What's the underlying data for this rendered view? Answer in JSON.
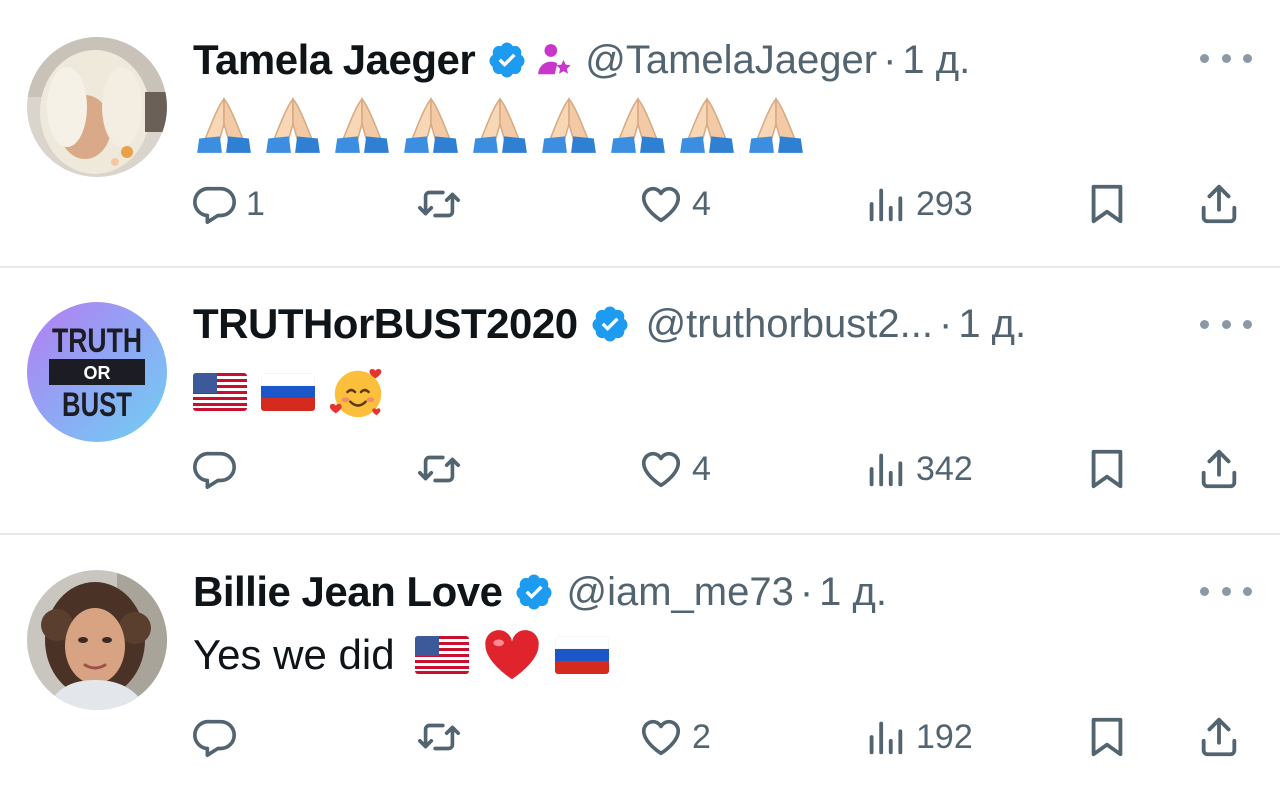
{
  "tweets": [
    {
      "name": "Tamela Jaeger",
      "verified": true,
      "affiliate_badge": "person-star-icon",
      "handle": "@TamelaJaeger",
      "dot": "·",
      "time": "1 д.",
      "text": "",
      "emojis": [
        "🙏🏻",
        "🙏🏻",
        "🙏🏻",
        "🙏🏻",
        "🙏🏻",
        "🙏🏻",
        "🙏🏻",
        "🙏🏻",
        "🙏🏻"
      ],
      "replies": "1",
      "reposts": "",
      "likes": "4",
      "views": "293"
    },
    {
      "name": "TRUTHorBUST2020",
      "verified": true,
      "handle": "@truthorbust2...",
      "dot": "·",
      "time": "1 д.",
      "text": "",
      "emojis": [
        "🇺🇸",
        "🇷🇺",
        "🥰"
      ],
      "avatar_text": [
        "TRUTH",
        "OR",
        "BUST"
      ],
      "replies": "",
      "reposts": "",
      "likes": "4",
      "views": "342"
    },
    {
      "name": "Billie Jean Love",
      "verified": true,
      "handle": "@iam_me73",
      "dot": "·",
      "time": "1 д.",
      "text": "Yes we did",
      "emojis": [
        "🇺🇸",
        "❤️",
        "🇷🇺"
      ],
      "replies": "",
      "reposts": "",
      "likes": "2",
      "views": "192"
    }
  ],
  "colors": {
    "verified": "#1d9bf0",
    "affiliate": "#c936cc",
    "secondary_text": "#536471",
    "divider": "#e6e9eb"
  }
}
